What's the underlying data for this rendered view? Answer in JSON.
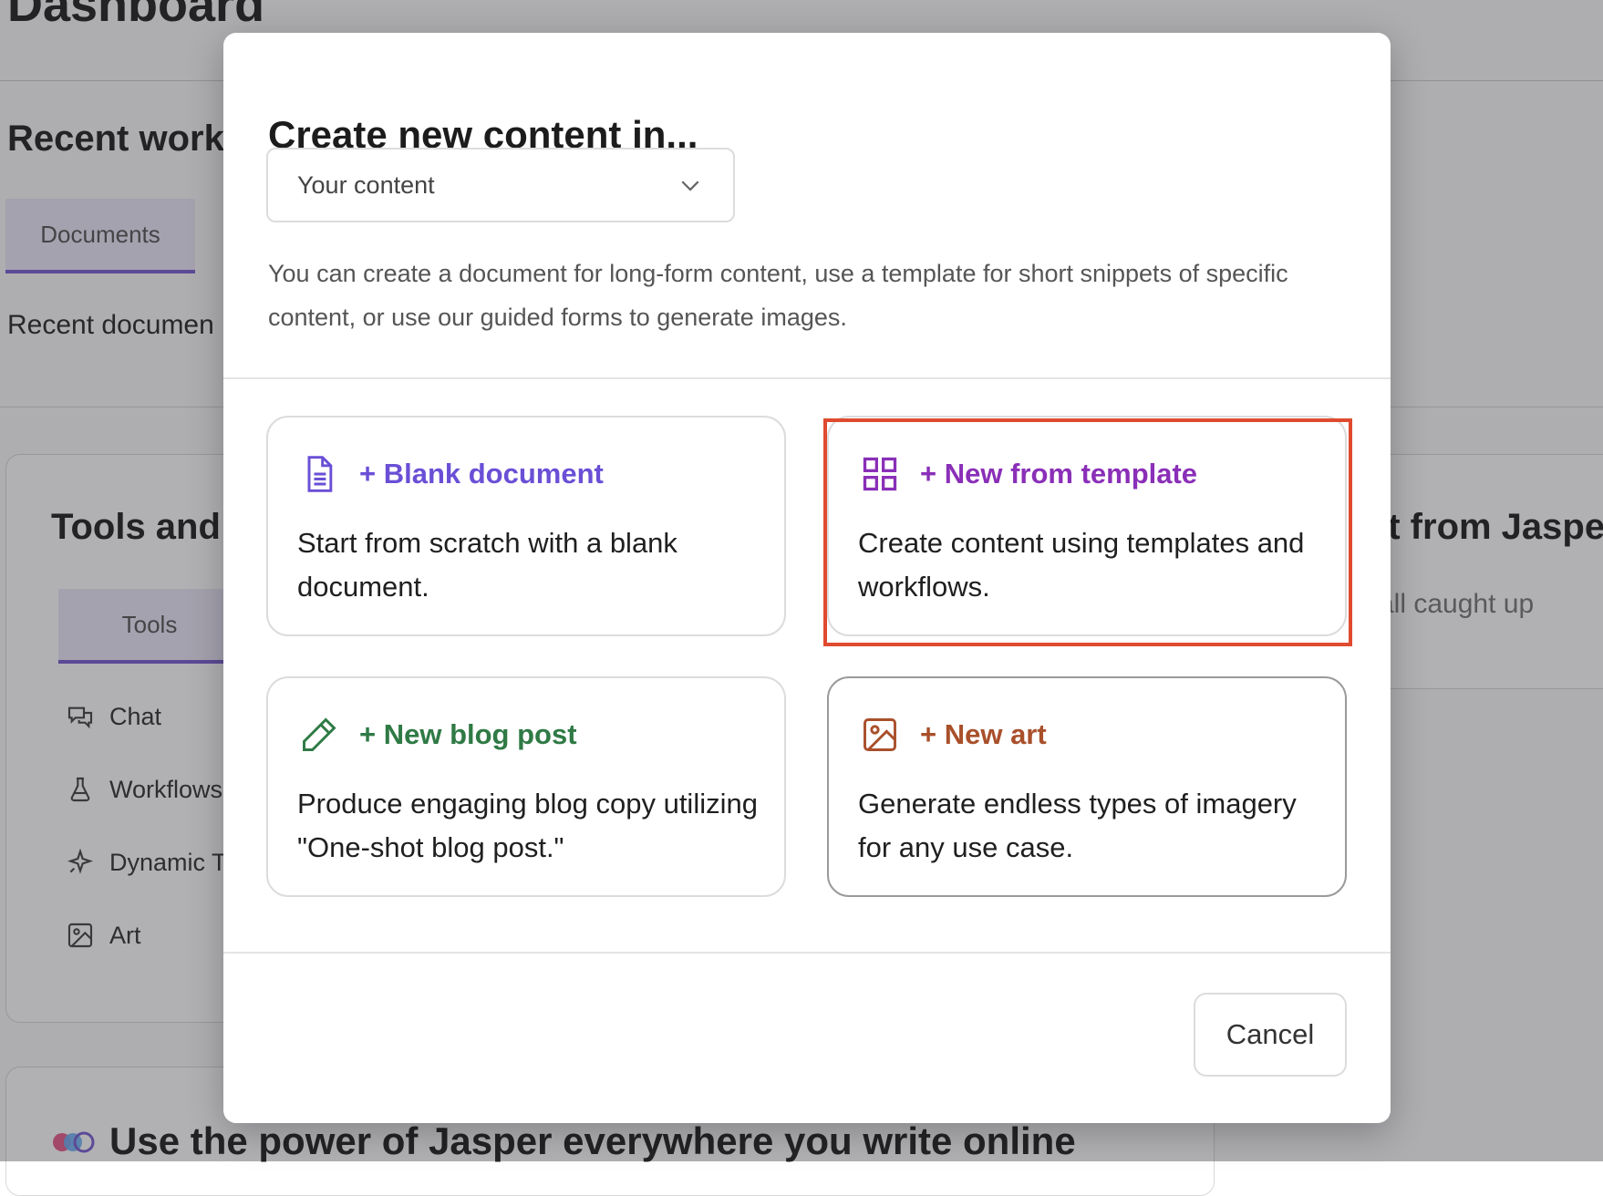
{
  "background": {
    "page_title": "Dashboard",
    "recent_work_heading": "Recent work",
    "recent_tab": "Documents",
    "recent_documents_text": "Recent documen",
    "tools_heading": "Tools and t",
    "tools_tab": "Tools",
    "tools": [
      {
        "label": "Chat",
        "icon": "chat-icon"
      },
      {
        "label": "Workflows",
        "icon": "flask-icon"
      },
      {
        "label": "Dynamic T",
        "icon": "sparkle-icon"
      },
      {
        "label": "Art",
        "icon": "image-icon"
      }
    ],
    "right_heading": "st from Jaspe",
    "right_subtext": "all caught up",
    "bottom_banner": "Use the power of Jasper everywhere you write online"
  },
  "modal": {
    "title": "Create new content in...",
    "select_value": "Your content",
    "description": "You can create a document for long-form content, use a template for short snippets of specific content, or use our guided forms to generate images.",
    "cards": [
      {
        "title": "+ Blank document",
        "desc": "Start from scratch with a blank document.",
        "icon": "document-icon",
        "color": "#6a4fd6"
      },
      {
        "title": "+ New from template",
        "desc": "Create content using templates and workflows.",
        "icon": "grid-icon",
        "color": "#8a2fb8"
      },
      {
        "title": "+ New blog post",
        "desc": "Produce engaging blog copy utilizing \"One-shot blog post.\"",
        "icon": "pencil-icon",
        "color": "#2f7a45"
      },
      {
        "title": "+ New art",
        "desc": "Generate endless types of imagery for any use case.",
        "icon": "image-icon",
        "color": "#a9502b"
      }
    ],
    "cancel_label": "Cancel",
    "highlight_color": "#e04a2f"
  }
}
